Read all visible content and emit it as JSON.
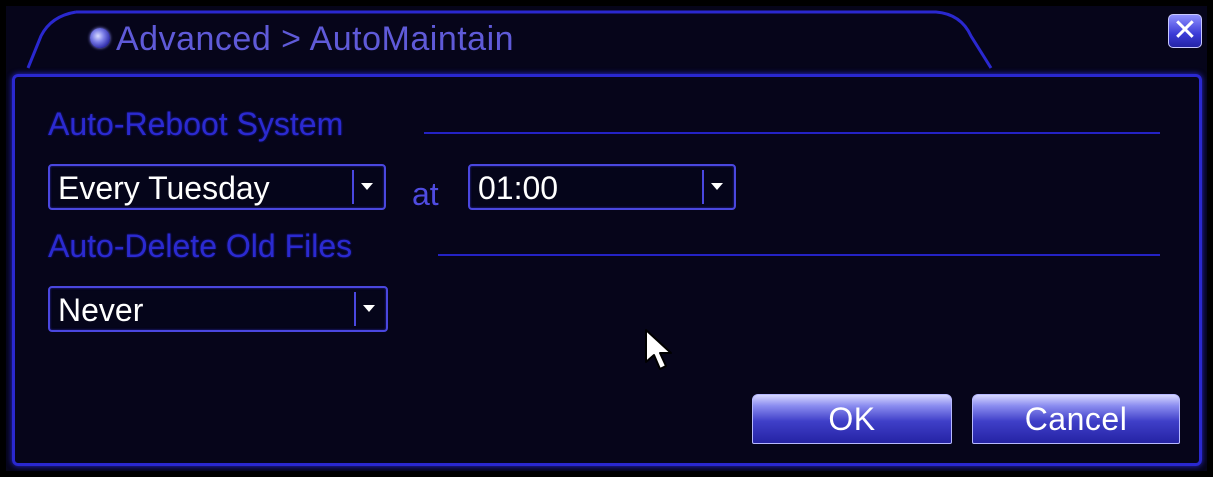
{
  "window": {
    "title": "Advanced > AutoMaintain",
    "close_symbol": "✕"
  },
  "auto_reboot": {
    "section_label": "Auto-Reboot System",
    "day_value": "Every Tuesday",
    "at_label": "at",
    "time_value": "01:00"
  },
  "auto_delete": {
    "section_label": "Auto-Delete Old Files",
    "value": "Never"
  },
  "buttons": {
    "ok_label": "OK",
    "cancel_label": "Cancel"
  },
  "icons": {
    "title": "disc-icon",
    "close": "close-icon",
    "dropdown": "chevron-down-icon",
    "cursor": "mouse-pointer-icon"
  },
  "colors": {
    "background": "#06051a",
    "accent": "#2a28cf",
    "section_text": "#2b2ad0",
    "value_text": "#ffffff"
  }
}
